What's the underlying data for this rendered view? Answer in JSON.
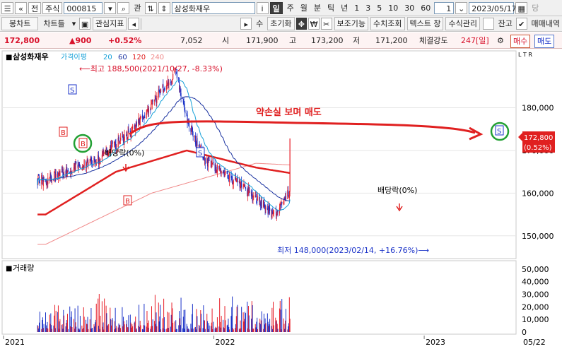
{
  "toolbar1": {
    "tab": "전",
    "market": "주식",
    "code": "000815",
    "right_label": "관",
    "name": "삼성화재우",
    "info": "i",
    "periods": [
      "일",
      "주",
      "월",
      "분",
      "틱",
      "년"
    ],
    "active_period": "일",
    "minutes": [
      "1",
      "3",
      "5",
      "10",
      "30",
      "60"
    ],
    "count": "1",
    "date": "2023/05/17",
    "tail": "당"
  },
  "toolbar2": {
    "items": [
      "봉차트",
      "차트틀",
      "관심지표",
      "수",
      "초기화",
      "보조기능",
      "수치조회",
      "텍스트 창",
      "수식관리"
    ],
    "janggo": "잔고",
    "trade": "매매내역"
  },
  "quote": {
    "price": "172,800",
    "change": "▲900",
    "pct": "+0.52%",
    "volume": "7,052",
    "open_label": "시",
    "open": "171,900",
    "high_label": "고",
    "high": "173,200",
    "low_label": "저",
    "low": "171,200",
    "strength_label": "체결강도",
    "strength": "247[일]",
    "buy": "매수",
    "sell": "매도"
  },
  "panel": {
    "name": "삼성화재우",
    "ind": "가격이평",
    "ma1": "20",
    "ma2": "60",
    "ma3": "120",
    "ma4": "240",
    "corner": "L T R"
  },
  "annotations": {
    "high_note": "⟵최고 188,500(2021/10/27, -8.33%)",
    "low_note": "최저 148,000(2023/02/14, +16.76%)⟶",
    "title_note": "약손실 보며 매도",
    "div1": "배당락(0%)",
    "div2": "배당락(0%)",
    "price_tag": "172,800",
    "price_pct": "(0.52%)",
    "b": "B",
    "s": "S"
  },
  "volume_panel": {
    "title": "거래량"
  },
  "colors": {
    "up": "#e8202a",
    "down": "#1a32c8",
    "ma20": "#14a0d8",
    "ma60": "#1a32a0",
    "ma120": "#e02020",
    "ma240": "#f08888",
    "circle": "#22a033",
    "tag": "#e02020"
  },
  "chart_data": {
    "type": "line",
    "price_ticks": [
      180000,
      170000,
      160000,
      150000
    ],
    "price_tick_labels": [
      "180,000",
      "170,000",
      "160,000",
      "150,000"
    ],
    "price_range": [
      145000,
      193000
    ],
    "volume_ticks": [
      50000,
      40000,
      30000,
      20000,
      10000,
      0
    ],
    "volume_tick_labels": [
      "50,000",
      "40,000",
      "30,000",
      "20,000",
      "10,000",
      "0"
    ],
    "volume_range": [
      0,
      55000
    ],
    "x_labels": [
      "2021",
      "2022",
      "2023",
      "05/22"
    ],
    "close_keypoints": [
      [
        "2021-03",
        163000
      ],
      [
        "2021-06",
        168000
      ],
      [
        "2021-08",
        175000
      ],
      [
        "2021-10-27",
        188500
      ],
      [
        "2021-11",
        177000
      ],
      [
        "2021-12",
        168000
      ],
      [
        "2022-02",
        162000
      ],
      [
        "2022-04",
        155000
      ],
      [
        "2022-06",
        167000
      ],
      [
        "2022-08",
        165000
      ],
      [
        "2022-10",
        157000
      ],
      [
        "2022-12",
        160000
      ],
      [
        "2023-01",
        165000
      ],
      [
        "2023-02-14",
        148000
      ],
      [
        "2023-03",
        158000
      ],
      [
        "2023-04",
        160000
      ],
      [
        "2023-05-17",
        172800
      ]
    ],
    "ma120_keypoints": [
      [
        "2021-03",
        155000
      ],
      [
        "2021-07",
        165000
      ],
      [
        "2021-11",
        170000
      ],
      [
        "2022-03",
        166000
      ],
      [
        "2022-06",
        164000
      ],
      [
        "2022-09",
        160000
      ],
      [
        "2022-12",
        158000
      ],
      [
        "2023-03",
        158000
      ],
      [
        "2023-05-17",
        160000
      ]
    ],
    "ma240_keypoints": [
      [
        "2021-03",
        148000
      ],
      [
        "2021-09",
        160000
      ],
      [
        "2022-03",
        167000
      ],
      [
        "2022-08",
        166000
      ],
      [
        "2023-01",
        161000
      ],
      [
        "2023-05-17",
        159000
      ]
    ],
    "high": {
      "date": "2021-10-27",
      "value": 188500
    },
    "low": {
      "date": "2023-02-14",
      "value": 148000
    },
    "last": 172800
  }
}
